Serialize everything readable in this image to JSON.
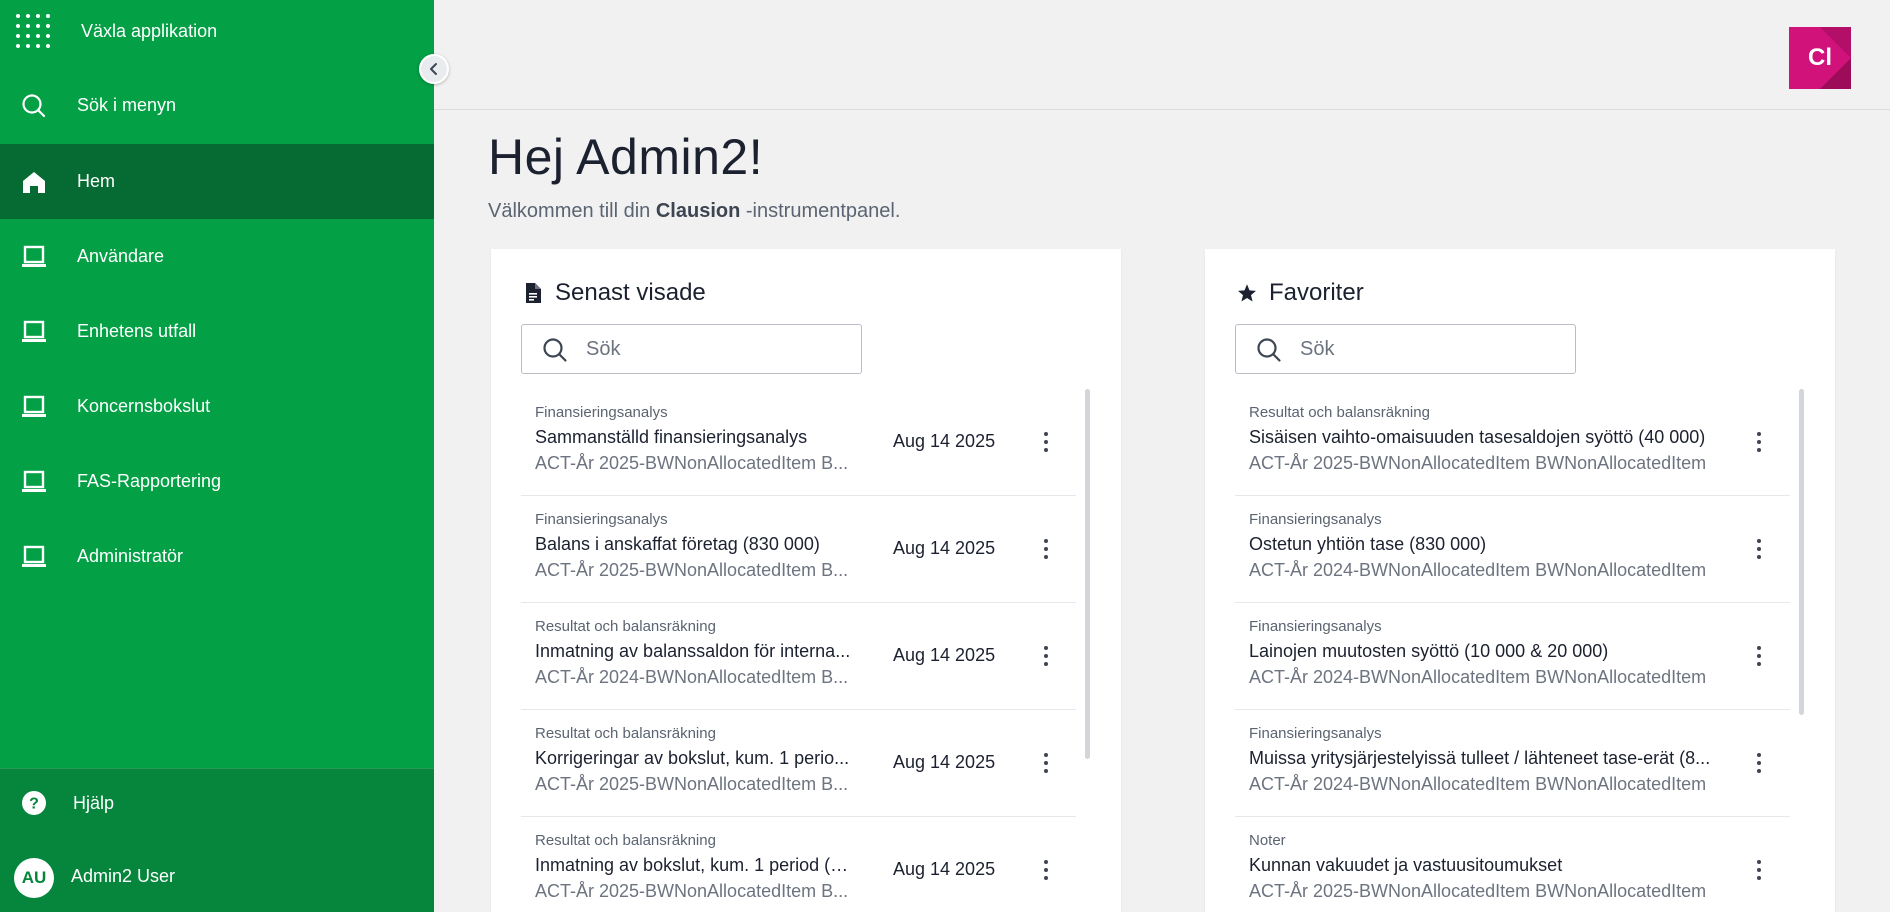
{
  "sidebar": {
    "switch_app": "Växla applikation",
    "search_menu": "Sök i menyn",
    "items": [
      {
        "label": "Hem"
      },
      {
        "label": "Användare"
      },
      {
        "label": "Enhetens utfall"
      },
      {
        "label": "Koncernsbokslut"
      },
      {
        "label": "FAS-Rapportering"
      },
      {
        "label": "Administratör"
      }
    ],
    "help": "Hjälp",
    "user": {
      "initials": "AU",
      "name": "Admin2 User"
    }
  },
  "header": {
    "app_logo": "Cl"
  },
  "main": {
    "greeting": "Hej Admin2!",
    "welcome_prefix": "Välkommen till din",
    "welcome_brand": "Clausion",
    "welcome_suffix": "-instrumentpanel."
  },
  "recent": {
    "title": "Senast visade",
    "search_placeholder": "Sök",
    "items": [
      {
        "category": "Finansieringsanalys",
        "title": "Sammanställd finansieringsanalys",
        "subtitle": "ACT-År 2025-BWNonAllocatedItem B...",
        "date": "Aug 14 2025"
      },
      {
        "category": "Finansieringsanalys",
        "title": "Balans i anskaffat företag (830 000)",
        "subtitle": "ACT-År 2025-BWNonAllocatedItem B...",
        "date": "Aug 14 2025"
      },
      {
        "category": "Resultat och balansräkning",
        "title": "Inmatning av balanssaldon för interna...",
        "subtitle": "ACT-År 2024-BWNonAllocatedItem B...",
        "date": "Aug 14 2025"
      },
      {
        "category": "Resultat och balansräkning",
        "title": "Korrigeringar av bokslut, kum. 1 perio...",
        "subtitle": "ACT-År 2025-BWNonAllocatedItem B...",
        "date": "Aug 14 2025"
      },
      {
        "category": "Resultat och balansräkning",
        "title": "Inmatning av bokslut, kum. 1 period (1...",
        "subtitle": "ACT-År 2025-BWNonAllocatedItem B...",
        "date": "Aug 14 2025"
      }
    ]
  },
  "favorites": {
    "title": "Favoriter",
    "search_placeholder": "Sök",
    "items": [
      {
        "category": "Resultat och balansräkning",
        "title": "Sisäisen vaihto-omaisuuden tasesaldojen syöttö (40 000)",
        "subtitle": "ACT-År 2025-BWNonAllocatedItem BWNonAllocatedItem"
      },
      {
        "category": "Finansieringsanalys",
        "title": "Ostetun yhtiön tase (830 000)",
        "subtitle": "ACT-År 2024-BWNonAllocatedItem BWNonAllocatedItem"
      },
      {
        "category": "Finansieringsanalys",
        "title": "Lainojen muutosten syöttö (10 000 & 20 000)",
        "subtitle": "ACT-År 2024-BWNonAllocatedItem BWNonAllocatedItem"
      },
      {
        "category": "Finansieringsanalys",
        "title": "Muissa yritysjärjestelyissä tulleet / lähteneet tase-erät (8...",
        "subtitle": "ACT-År 2024-BWNonAllocatedItem BWNonAllocatedItem"
      },
      {
        "category": "Noter",
        "title": "Kunnan vakuudet ja vastuusitoumukset",
        "subtitle": "ACT-År 2025-BWNonAllocatedItem BWNonAllocatedItem"
      }
    ]
  },
  "colors": {
    "sidebar": "#03a046",
    "sidebar_active": "#066b33",
    "sidebar_bottom": "#05863c",
    "logo": "#d1127a"
  }
}
